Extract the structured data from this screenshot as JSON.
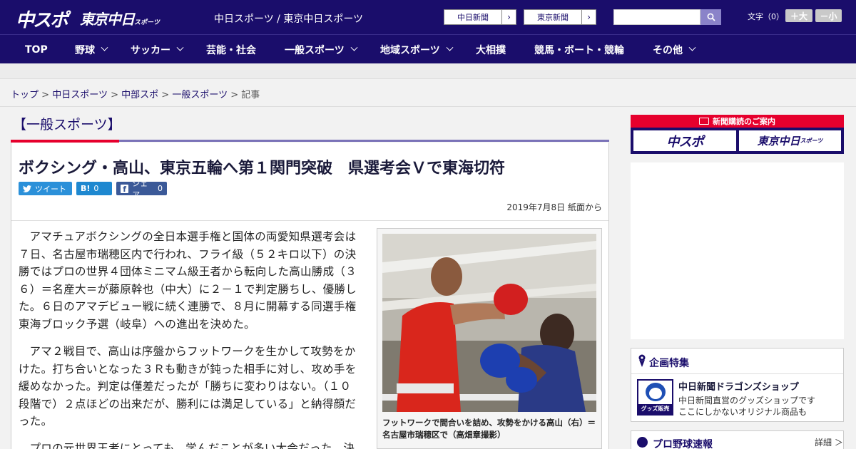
{
  "header": {
    "logo_main": "中スポ",
    "logo_tokyo": "東京中日",
    "logo_tokyo_small": "スポーツ",
    "site_names": "中日スポーツ / 東京中日スポーツ",
    "paper_links": [
      {
        "label": "中日新聞"
      },
      {
        "label": "東京新聞"
      }
    ],
    "search_placeholder": "",
    "font_size_label": "文字（0）",
    "font_larger": "＋大",
    "font_smaller": "－小"
  },
  "nav": {
    "items": [
      {
        "label": "TOP",
        "has_menu": false
      },
      {
        "label": "野球",
        "has_menu": true
      },
      {
        "label": "サッカー",
        "has_menu": true
      },
      {
        "label": "芸能・社会",
        "has_menu": false
      },
      {
        "label": "一般スポーツ",
        "has_menu": true
      },
      {
        "label": "地域スポーツ",
        "has_menu": true
      },
      {
        "label": "大相撲",
        "has_menu": false
      },
      {
        "label": "競馬・ボート・競輪",
        "has_menu": false
      },
      {
        "label": "その他",
        "has_menu": true
      }
    ]
  },
  "breadcrumb": {
    "items": [
      "トップ",
      "中日スポーツ",
      "中部スポ",
      "一般スポーツ"
    ],
    "separator": ">",
    "current": "記事"
  },
  "article": {
    "category": "【一般スポーツ】",
    "headline": "ボクシング・高山、東京五輪へ第１関門突破　県選考会Ｖで東海切符",
    "share": {
      "tweet_label": "ツイート",
      "hatena_label": "B!",
      "hatena_count": "0",
      "fb_label": "シェア",
      "fb_count": "0"
    },
    "date": "2019年7月8日 紙面から",
    "paragraphs": [
      "アマチュアボクシングの全日本選手権と国体の両愛知県選考会は７日、名古屋市瑞穂区内で行われ、フライ級（５２キロ以下）の決勝ではプロの世界４団体ミニマム級王者から転向した高山勝成（３６）＝名産大＝が藤原幹也（中大）に２－１で判定勝ちし、優勝した。６日のアマデビュー戦に続く連勝で、８月に開幕する同選手権東海ブロック予選（岐阜）への進出を決めた。",
      "アマ２戦目で、高山は序盤からフットワークを生かして攻勢をかけた。打ち合いとなった３Ｒも動きが鈍った相手に対し、攻め手を緩めなかった。判定は僅差だったが「勝ちに変わりはない。（１０段階で）２点ほどの出来だが、勝利には満足している」と納得顔だった。",
      "プロの元世界王者にとっても、学んだことが多い大会だった。決"
    ],
    "photo_caption": "フットワークで間合いを詰め、攻勢をかける高山（右）＝名古屋市瑞穂区で（高畑章撮影）"
  },
  "sidebar": {
    "subscription_title": "新聞購読のご案内",
    "sub_logo_1": "中スポ",
    "sub_logo_2": "東京中日",
    "sub_logo_2_small": "スポーツ",
    "feature": {
      "title": "企画特集",
      "item_title": "中日新聞ドラゴンズショップ",
      "item_desc_1": "中日新聞直営のグッズショップです",
      "item_desc_2": "ここにしかないオリジナル商品も",
      "thumb_label": "グッズ販売中"
    },
    "baseball": {
      "title": "プロ野球速報",
      "more": "詳細 ＞"
    }
  },
  "colors": {
    "brand_navy": "#1a0d6b",
    "accent_red": "#e6002d",
    "twitter": "#2b90d9",
    "hatena": "#1e88d0",
    "facebook": "#3b5998"
  }
}
